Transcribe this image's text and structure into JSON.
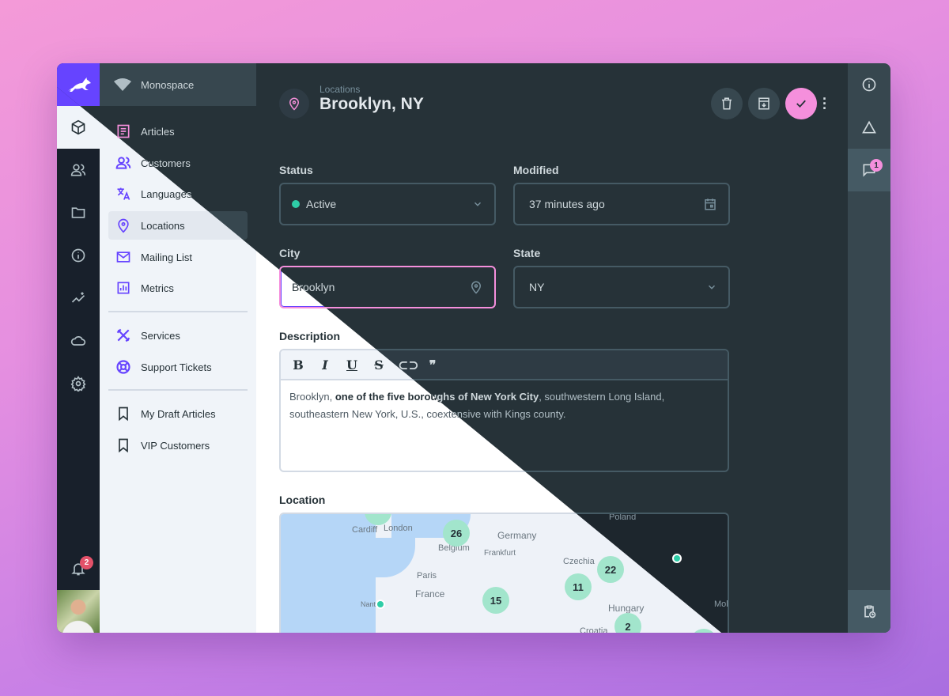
{
  "workspace": "Monospace",
  "rail": {
    "items": [
      "box",
      "users",
      "folder",
      "info",
      "insights",
      "cloud",
      "settings"
    ],
    "notifications_badge": "2"
  },
  "nav": {
    "groups": [
      [
        {
          "label": "Articles",
          "icon": "article-icon"
        },
        {
          "label": "Customers",
          "icon": "users-icon"
        },
        {
          "label": "Languages",
          "icon": "translate-icon"
        },
        {
          "label": "Locations",
          "icon": "location-pin-icon",
          "active": true
        },
        {
          "label": "Mailing List",
          "icon": "mail-icon"
        },
        {
          "label": "Metrics",
          "icon": "chart-icon"
        }
      ],
      [
        {
          "label": "Services",
          "icon": "tools-icon"
        },
        {
          "label": "Support Tickets",
          "icon": "lifebuoy-icon"
        }
      ],
      [
        {
          "label": "My Draft Articles",
          "icon": "bookmark-icon"
        },
        {
          "label": "VIP Customers",
          "icon": "bookmark-icon"
        }
      ]
    ]
  },
  "header": {
    "breadcrumb": "Locations",
    "title": "Brooklyn, NY"
  },
  "form": {
    "status": {
      "label": "Status",
      "value": "Active",
      "color": "#2ecda7"
    },
    "modified": {
      "label": "Modified",
      "value": "37 minutes ago"
    },
    "city": {
      "label": "City",
      "value": "Brooklyn"
    },
    "state": {
      "label": "State",
      "value": "NY"
    },
    "description": {
      "label": "Description",
      "text_pre": "Brooklyn, ",
      "text_bold": "one of the five boroughs of New York City",
      "text_post": ", southwestern Long Island, southeastern New York, U.S., coextensive with Kings county."
    },
    "location": {
      "label": "Location"
    }
  },
  "map": {
    "labels": [
      "Cardiff",
      "London",
      "Belgium",
      "Germany",
      "Frankfurt",
      "Paris",
      "France",
      "Czechia",
      "Hungary",
      "Croatia",
      "Poland",
      "Nantes",
      "Mol"
    ],
    "clusters": [
      "26",
      "15",
      "11",
      "22",
      "2"
    ]
  },
  "right_rail": {
    "comments_badge": "1"
  },
  "colors": {
    "accent": "#6644ff",
    "save": "#f58fdc",
    "badge_red": "#e35169"
  }
}
